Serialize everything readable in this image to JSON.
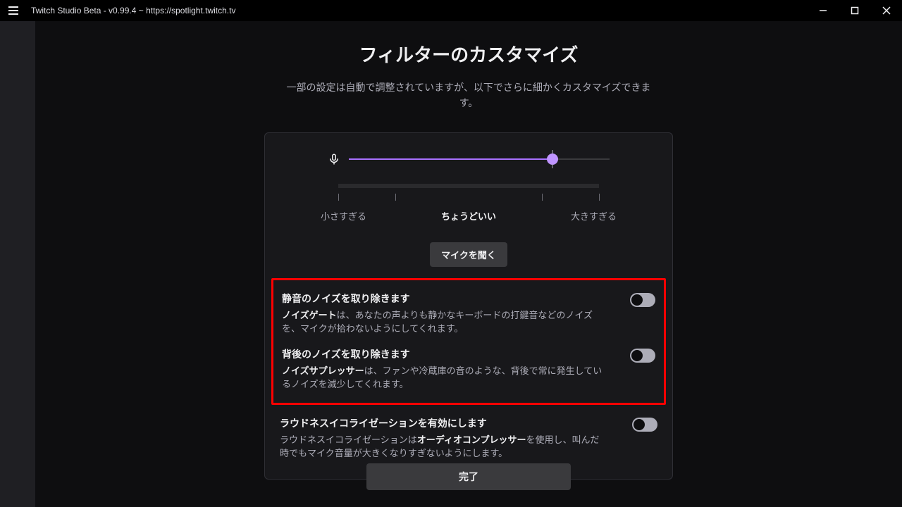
{
  "window": {
    "title": "Twitch Studio Beta - v0.99.4 ~ https://spotlight.twitch.tv"
  },
  "header": {
    "title": "フィルターのカスタマイズ",
    "subtitle": "一部の設定は自動で調整されていますが、以下でさらに細かくカスタマイズできます。"
  },
  "slider": {
    "value_pct": 78,
    "labels": {
      "low": "小さすぎる",
      "mid": "ちょうどいい",
      "high": "大きすぎる"
    },
    "listen_button": "マイクを聞く"
  },
  "filters": [
    {
      "title": "静音のノイズを取り除きます",
      "bold": "ノイズゲート",
      "desc_rest": "は、あなたの声よりも静かなキーボードの打鍵音などのノイズを、マイクが拾わないようにしてくれます。",
      "enabled": false,
      "highlighted": true
    },
    {
      "title": "背後のノイズを取り除きます",
      "bold": "ノイズサプレッサー",
      "desc_rest": "は、ファンや冷蔵庫の音のような、背後で常に発生しているノイズを減少してくれます。",
      "enabled": false,
      "highlighted": true
    },
    {
      "title": "ラウドネスイコライゼーションを有効にします",
      "lead": "ラウドネスイコライゼーションは",
      "bold": "オーディオコンプレッサー",
      "desc_rest": "を使用し、叫んだ時でもマイク音量が大きくなりすぎないようにします。",
      "enabled": false,
      "highlighted": false
    }
  ],
  "footer": {
    "done": "完了"
  }
}
